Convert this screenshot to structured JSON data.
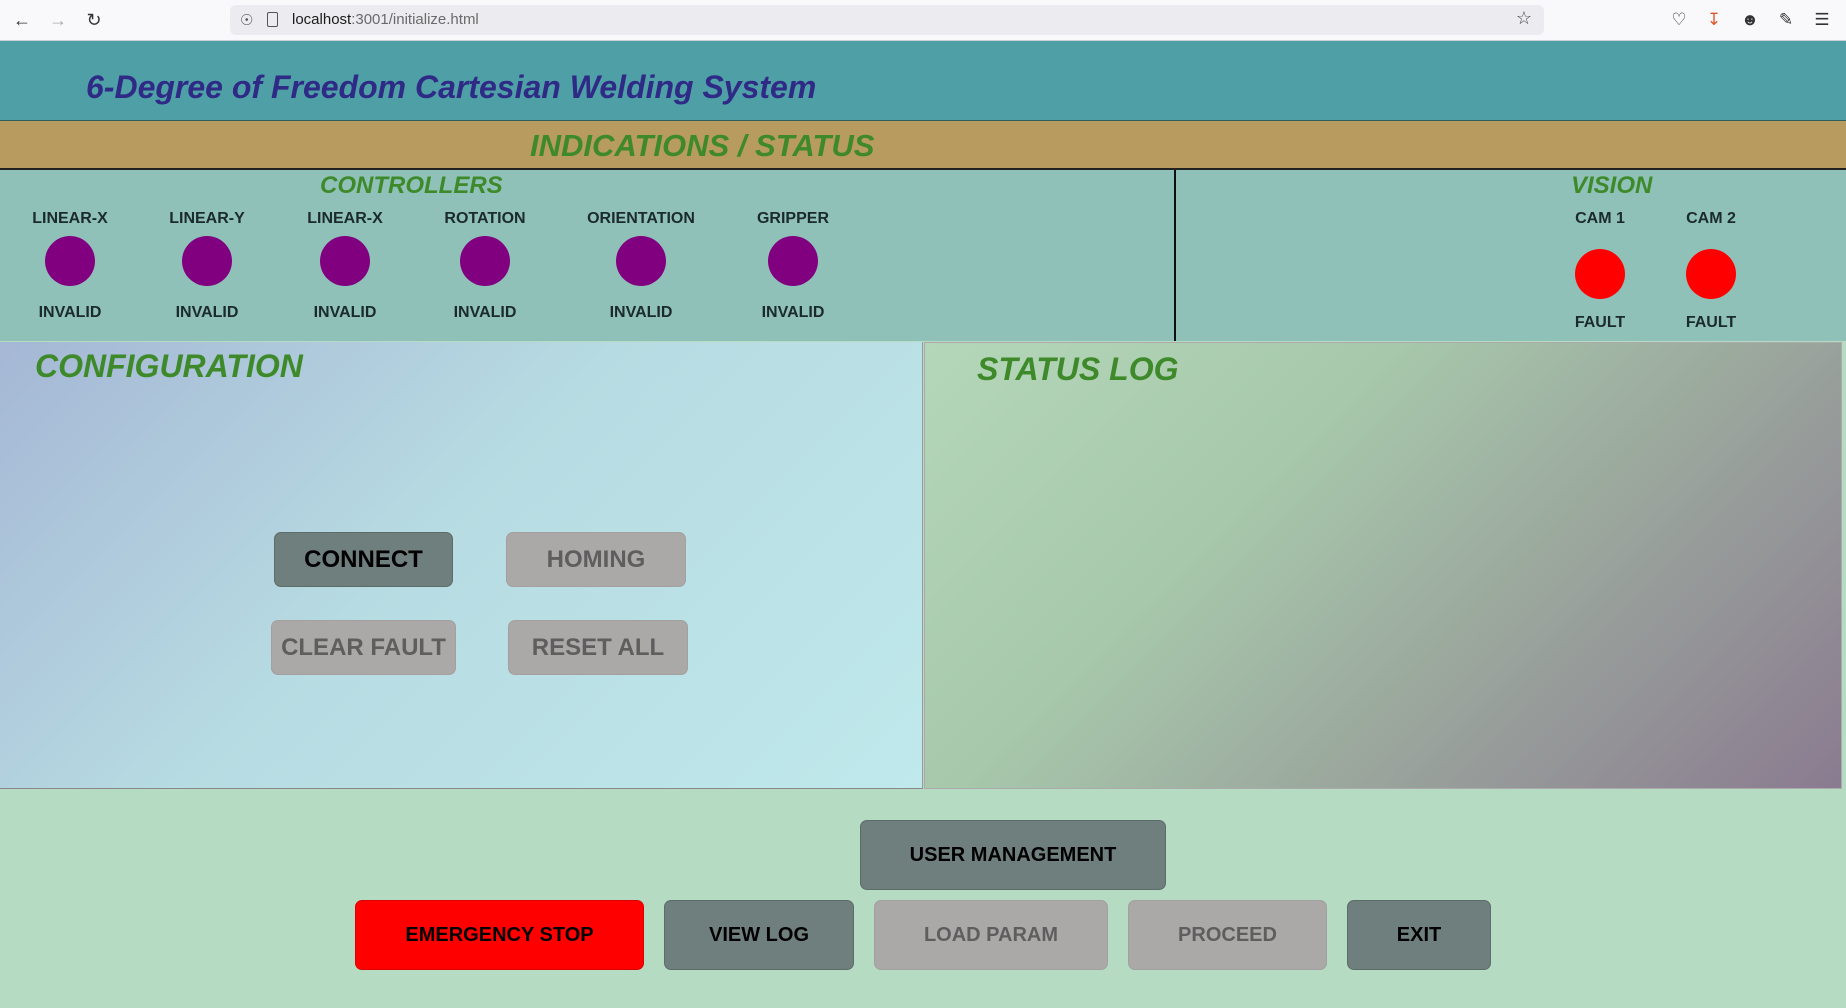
{
  "browser": {
    "url_host": "localhost",
    "url_path": ":3001/initialize.html"
  },
  "app": {
    "title": "6-Degree of Freedom Cartesian Welding System"
  },
  "indications": {
    "title": "INDICATIONS / STATUS"
  },
  "controllers": {
    "title": "CONTROLLERS",
    "items": [
      {
        "label": "LINEAR-X",
        "status": "INVALID",
        "color": "#800080"
      },
      {
        "label": "LINEAR-Y",
        "status": "INVALID",
        "color": "#800080"
      },
      {
        "label": "LINEAR-X",
        "status": "INVALID",
        "color": "#800080"
      },
      {
        "label": "ROTATION",
        "status": "INVALID",
        "color": "#800080"
      },
      {
        "label": "ORIENTATION",
        "status": "INVALID",
        "color": "#800080"
      },
      {
        "label": "GRIPPER",
        "status": "INVALID",
        "color": "#800080"
      }
    ]
  },
  "vision": {
    "title": "VISION",
    "items": [
      {
        "label": "CAM 1",
        "status": "FAULT",
        "color": "#ff0000"
      },
      {
        "label": "CAM 2",
        "status": "FAULT",
        "color": "#ff0000"
      }
    ]
  },
  "configuration": {
    "title": "CONFIGURATION",
    "connect": "CONNECT",
    "homing": "HOMING",
    "clear_fault": "CLEAR FAULT",
    "reset_all": "RESET ALL"
  },
  "status_log": {
    "title": "STATUS LOG"
  },
  "footer": {
    "user_management": "USER MANAGEMENT",
    "emergency_stop": "EMERGENCY STOP",
    "view_log": "VIEW LOG",
    "load_param": "LOAD PARAM",
    "proceed": "PROCEED",
    "exit": "EXIT"
  },
  "colors": {
    "header_bg": "#4f9fa7",
    "indications_bg": "#b89b5e",
    "section_title": "#3e8a2b",
    "app_title": "#2e2a86",
    "button_active": "#6f7f7d",
    "button_disabled": "#aba8a8",
    "button_danger": "#ff0000"
  }
}
